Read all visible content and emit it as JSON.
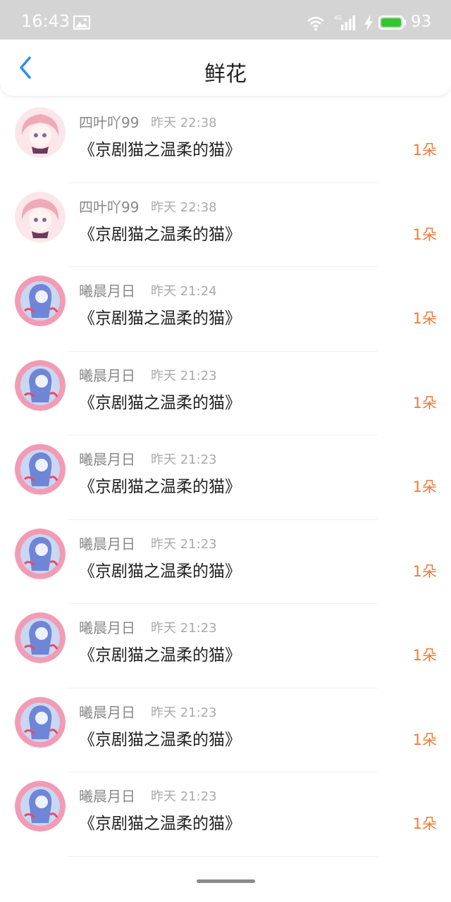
{
  "status_bar": {
    "time": "16:43",
    "battery": "93",
    "network": "4G",
    "icons": [
      "image-icon",
      "wifi-icon",
      "signal-icon",
      "charging-icon",
      "battery-icon"
    ]
  },
  "header": {
    "title": "鲜花",
    "back_icon": "chevron-left-icon",
    "accent_color": "#2a8ee8"
  },
  "colors": {
    "count": "#f07b37",
    "name": "#888888",
    "time": "#aaaaaa",
    "title": "#222222"
  },
  "items": [
    {
      "name": "四叶吖99",
      "time": "昨天 22:38",
      "title": "《京剧猫之温柔的猫》",
      "count": "1朵",
      "avatar": "pink-hair-girl-avatar"
    },
    {
      "name": "四叶吖99",
      "time": "昨天 22:38",
      "title": "《京剧猫之温柔的猫》",
      "count": "1朵",
      "avatar": "pink-hair-girl-avatar"
    },
    {
      "name": "曦晨月日",
      "time": "昨天 21:24",
      "title": "《京剧猫之温柔的猫》",
      "count": "1朵",
      "avatar": "blue-anime-avatar"
    },
    {
      "name": "曦晨月日",
      "time": "昨天 21:23",
      "title": "《京剧猫之温柔的猫》",
      "count": "1朵",
      "avatar": "blue-anime-avatar"
    },
    {
      "name": "曦晨月日",
      "time": "昨天 21:23",
      "title": "《京剧猫之温柔的猫》",
      "count": "1朵",
      "avatar": "blue-anime-avatar"
    },
    {
      "name": "曦晨月日",
      "time": "昨天 21:23",
      "title": "《京剧猫之温柔的猫》",
      "count": "1朵",
      "avatar": "blue-anime-avatar"
    },
    {
      "name": "曦晨月日",
      "time": "昨天 21:23",
      "title": "《京剧猫之温柔的猫》",
      "count": "1朵",
      "avatar": "blue-anime-avatar"
    },
    {
      "name": "曦晨月日",
      "time": "昨天 21:23",
      "title": "《京剧猫之温柔的猫》",
      "count": "1朵",
      "avatar": "blue-anime-avatar"
    },
    {
      "name": "曦晨月日",
      "time": "昨天 21:23",
      "title": "《京剧猫之温柔的猫》",
      "count": "1朵",
      "avatar": "blue-anime-avatar"
    }
  ]
}
